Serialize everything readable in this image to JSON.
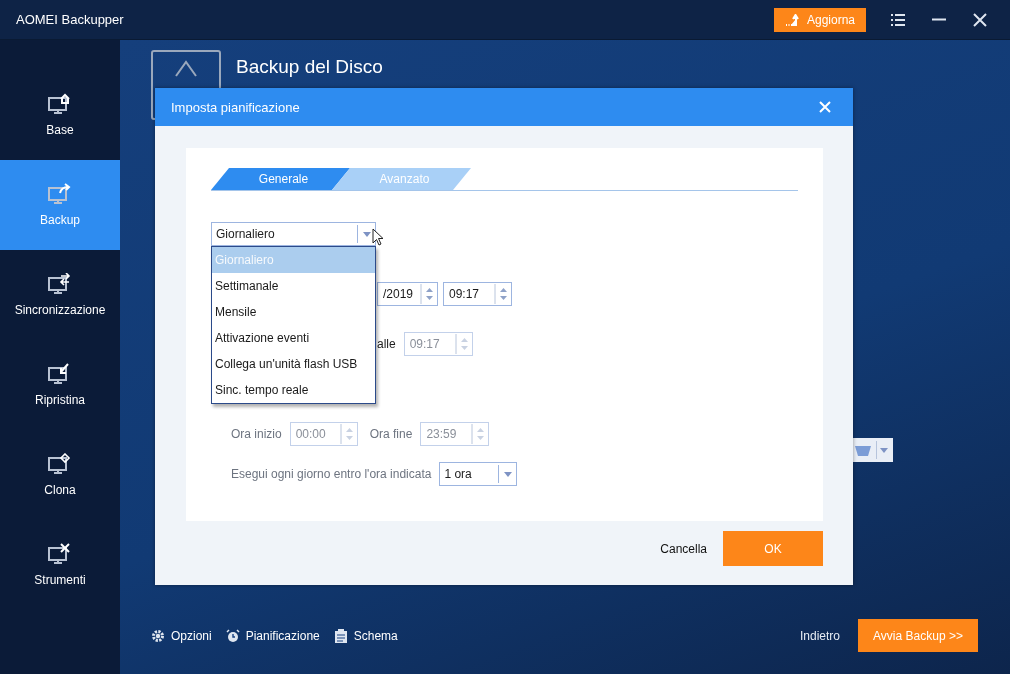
{
  "app": {
    "title": "AOMEI Backupper",
    "upgrade_button": "Aggiorna"
  },
  "sidebar": {
    "items": [
      {
        "label": "Base",
        "selected": false
      },
      {
        "label": "Backup",
        "selected": true
      },
      {
        "label": "Sincronizzazione",
        "selected": false
      },
      {
        "label": "Ripristina",
        "selected": false
      },
      {
        "label": "Clona",
        "selected": false
      },
      {
        "label": "Strumenti",
        "selected": false
      }
    ]
  },
  "page": {
    "title": "Backup del Disco"
  },
  "bottom_bar": {
    "links": [
      "Opzioni",
      "Pianificazione",
      "Schema"
    ],
    "back": "Indietro",
    "start": "Avvia Backup >>"
  },
  "dialog": {
    "title": "Imposta pianificazione",
    "tabs": [
      {
        "label": "Generale",
        "selected": true
      },
      {
        "label": "Avanzato",
        "selected": false
      }
    ],
    "frequency": {
      "value": "Giornaliero",
      "expanded": true,
      "options": [
        {
          "label": "Giornaliero",
          "selected": true
        },
        {
          "label": "Settimanale",
          "selected": false
        },
        {
          "label": "Mensile",
          "selected": false
        },
        {
          "label": "Attivazione eventi",
          "selected": false
        },
        {
          "label": "Collega un'unità flash USB",
          "selected": false
        },
        {
          "label": "Sinc. tempo reale",
          "selected": false
        }
      ]
    },
    "date_field": {
      "value": "/2019",
      "disabled": false
    },
    "time_field": {
      "value": "09:17",
      "disabled": false
    },
    "repeat_label": "alle",
    "repeat_time": {
      "value": "09:17",
      "disabled": true
    },
    "start_label": "Ora inizio",
    "start_time": {
      "value": "00:00",
      "disabled": true
    },
    "end_label": "Ora fine",
    "end_time": {
      "value": "23:59",
      "disabled": true
    },
    "within_label": "Esegui ogni giorno entro l'ora indicata",
    "within_select": {
      "value": "1 ora"
    },
    "cancel": "Cancella",
    "ok": "OK"
  }
}
